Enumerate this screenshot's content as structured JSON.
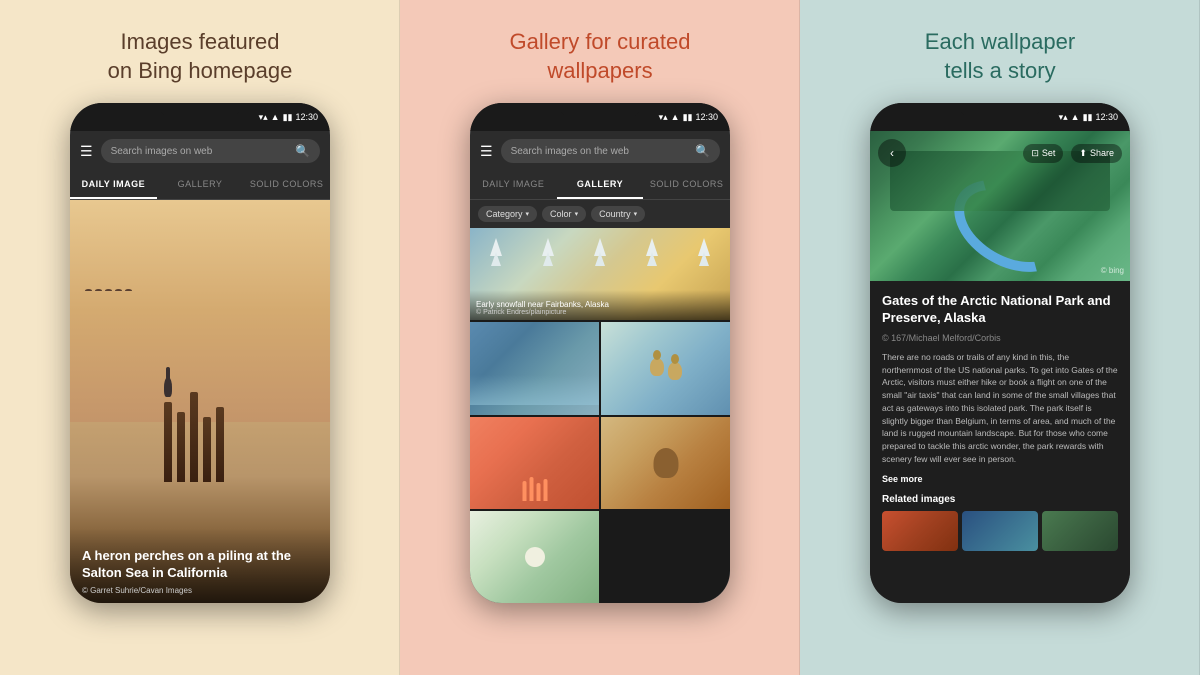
{
  "panels": [
    {
      "id": "panel-1",
      "title": "Images featured\non Bing homepage",
      "tabs": [
        {
          "label": "DAILY IMAGE",
          "active": true
        },
        {
          "label": "GALLERY",
          "active": false
        },
        {
          "label": "SOLID COLORS",
          "active": false
        }
      ],
      "search_placeholder": "Search images on web",
      "caption_title": "A heron perches on a piling at the Salton Sea in California",
      "caption_credit": "© Garret Suhrie/Cavan Images"
    },
    {
      "id": "panel-2",
      "title": "Gallery for curated\nwallpapers",
      "tabs": [
        {
          "label": "DAILY IMAGE",
          "active": false
        },
        {
          "label": "GALLERY",
          "active": true
        },
        {
          "label": "SOLID COLORS",
          "active": false
        }
      ],
      "search_placeholder": "Search images on the web",
      "filters": [
        {
          "label": "Category"
        },
        {
          "label": "Color"
        },
        {
          "label": "Country"
        }
      ],
      "gallery_items": [
        {
          "caption": "Early snowfall near Fairbanks, Alaska",
          "credit": "© Patrick Endres/plainpicture",
          "wide": true
        },
        {
          "caption": "",
          "credit": ""
        },
        {
          "caption": "",
          "credit": ""
        },
        {
          "caption": "",
          "credit": ""
        },
        {
          "caption": "",
          "credit": ""
        }
      ]
    },
    {
      "id": "panel-3",
      "title": "Each wallpaper\ntells a story",
      "story_title": "Gates of the Arctic National Park and Preserve, Alaska",
      "story_credit": "© 167/Michael Melford/Corbis",
      "story_body": "There are no roads or trails of any kind in this, the northernmost of the US national parks. To get into Gates of the Arctic, visitors must either hike or book a flight on one of the small \"air taxis\" that can land in some of the small villages that act as gateways into this isolated park. The park itself is slightly bigger than Belgium, in terms of area, and much of the land is rugged mountain landscape. But for those who come prepared to tackle this arctic wonder, the park rewards with scenery few will ever see in person.",
      "see_more_label": "See more",
      "related_label": "Related images",
      "set_label": "Set",
      "share_label": "Share",
      "bing_credit": "© bing"
    }
  ],
  "status_bar": {
    "time": "12:30",
    "icons": [
      "▼",
      "▲",
      "●●●●",
      "▮▮▮▮"
    ]
  }
}
